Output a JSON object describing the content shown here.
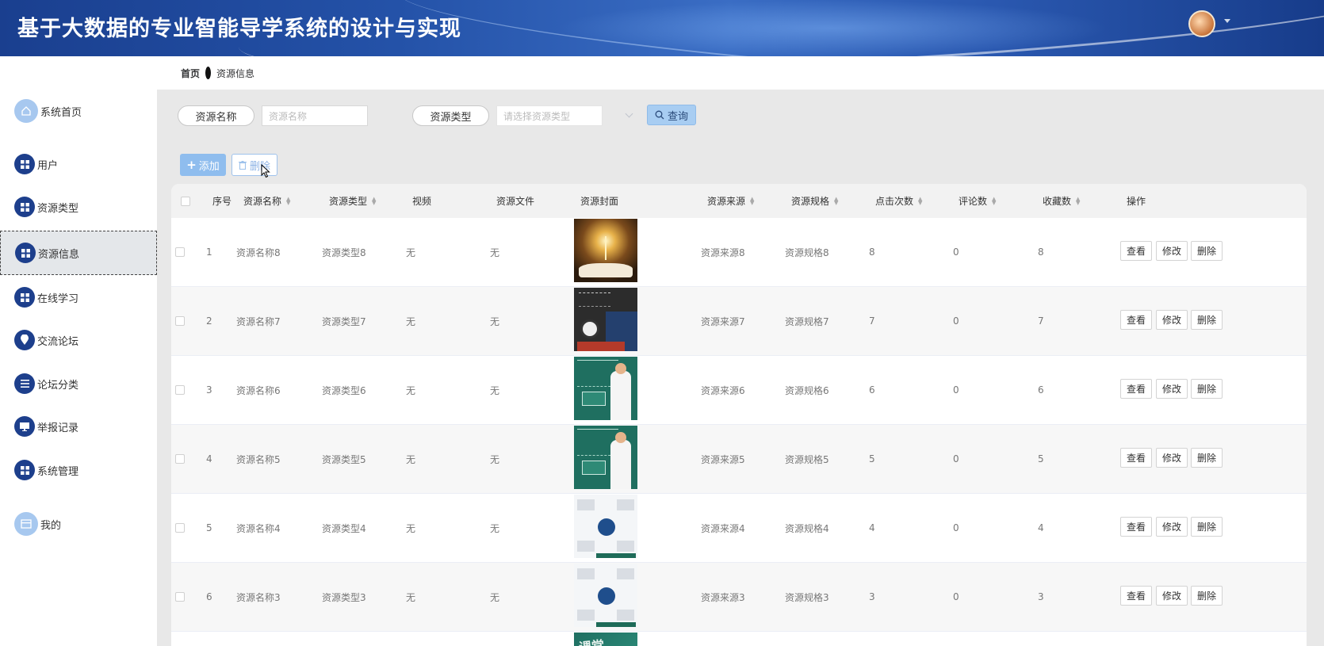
{
  "header": {
    "title": "基于大数据的专业智能导学系统的设计与实现"
  },
  "sidebar": {
    "items": [
      {
        "label": "系统首页",
        "icon": "home-icon"
      },
      {
        "label": "用户",
        "icon": "grid-icon"
      },
      {
        "label": "资源类型",
        "icon": "grid-icon"
      },
      {
        "label": "资源信息",
        "icon": "grid-icon",
        "active": true
      },
      {
        "label": "在线学习",
        "icon": "grid-icon"
      },
      {
        "label": "交流论坛",
        "icon": "location-pin-icon"
      },
      {
        "label": "论坛分类",
        "icon": "list-icon"
      },
      {
        "label": "举报记录",
        "icon": "monitor-icon"
      },
      {
        "label": "系统管理",
        "icon": "grid-icon"
      },
      {
        "label": "我的",
        "icon": "card-icon"
      }
    ]
  },
  "breadcrumb": {
    "home": "首页",
    "current": "资源信息"
  },
  "search": {
    "name_label": "资源名称",
    "name_placeholder": "资源名称",
    "type_label": "资源类型",
    "type_placeholder": "请选择资源类型",
    "query_label": "查询"
  },
  "actions": {
    "add_label": "添加",
    "delete_label": "删除"
  },
  "table": {
    "headers": {
      "index": "序号",
      "name": "资源名称",
      "type": "资源类型",
      "video": "视频",
      "file": "资源文件",
      "cover": "资源封面",
      "source": "资源来源",
      "spec": "资源规格",
      "clicks": "点击次数",
      "comments": "评论数",
      "favorites": "收藏数",
      "ops": "操作"
    },
    "op_labels": {
      "view": "查看",
      "edit": "修改",
      "delete": "删除"
    },
    "rows": [
      {
        "index": "1",
        "name": "资源名称8",
        "type": "资源类型8",
        "video": "无",
        "file": "无",
        "cover": "book-lightbulb",
        "source": "资源来源8",
        "spec": "资源规格8",
        "clicks": "8",
        "comments": "0",
        "favorites": "8"
      },
      {
        "index": "2",
        "name": "资源名称7",
        "type": "资源类型7",
        "video": "无",
        "file": "无",
        "cover": "chalkboard-clock",
        "source": "资源来源7",
        "spec": "资源规格7",
        "clicks": "7",
        "comments": "0",
        "favorites": "7"
      },
      {
        "index": "3",
        "name": "资源名称6",
        "type": "资源类型6",
        "video": "无",
        "file": "无",
        "cover": "green-board-child",
        "source": "资源来源6",
        "spec": "资源规格6",
        "clicks": "6",
        "comments": "0",
        "favorites": "6"
      },
      {
        "index": "4",
        "name": "资源名称5",
        "type": "资源类型5",
        "video": "无",
        "file": "无",
        "cover": "green-board-child",
        "source": "资源来源5",
        "spec": "资源规格5",
        "clicks": "5",
        "comments": "0",
        "favorites": "5"
      },
      {
        "index": "5",
        "name": "资源名称4",
        "type": "资源类型4",
        "video": "无",
        "file": "无",
        "cover": "mindmap",
        "source": "资源来源4",
        "spec": "资源规格4",
        "clicks": "4",
        "comments": "0",
        "favorites": "4"
      },
      {
        "index": "6",
        "name": "资源名称3",
        "type": "资源类型3",
        "video": "无",
        "file": "无",
        "cover": "mindmap",
        "source": "资源来源3",
        "spec": "资源规格3",
        "clicks": "3",
        "comments": "0",
        "favorites": "3"
      }
    ]
  },
  "colors": {
    "header_blue": "#1d3f8c",
    "accent_light": "#a8cdf2",
    "main_bg": "#e8e8e8"
  }
}
